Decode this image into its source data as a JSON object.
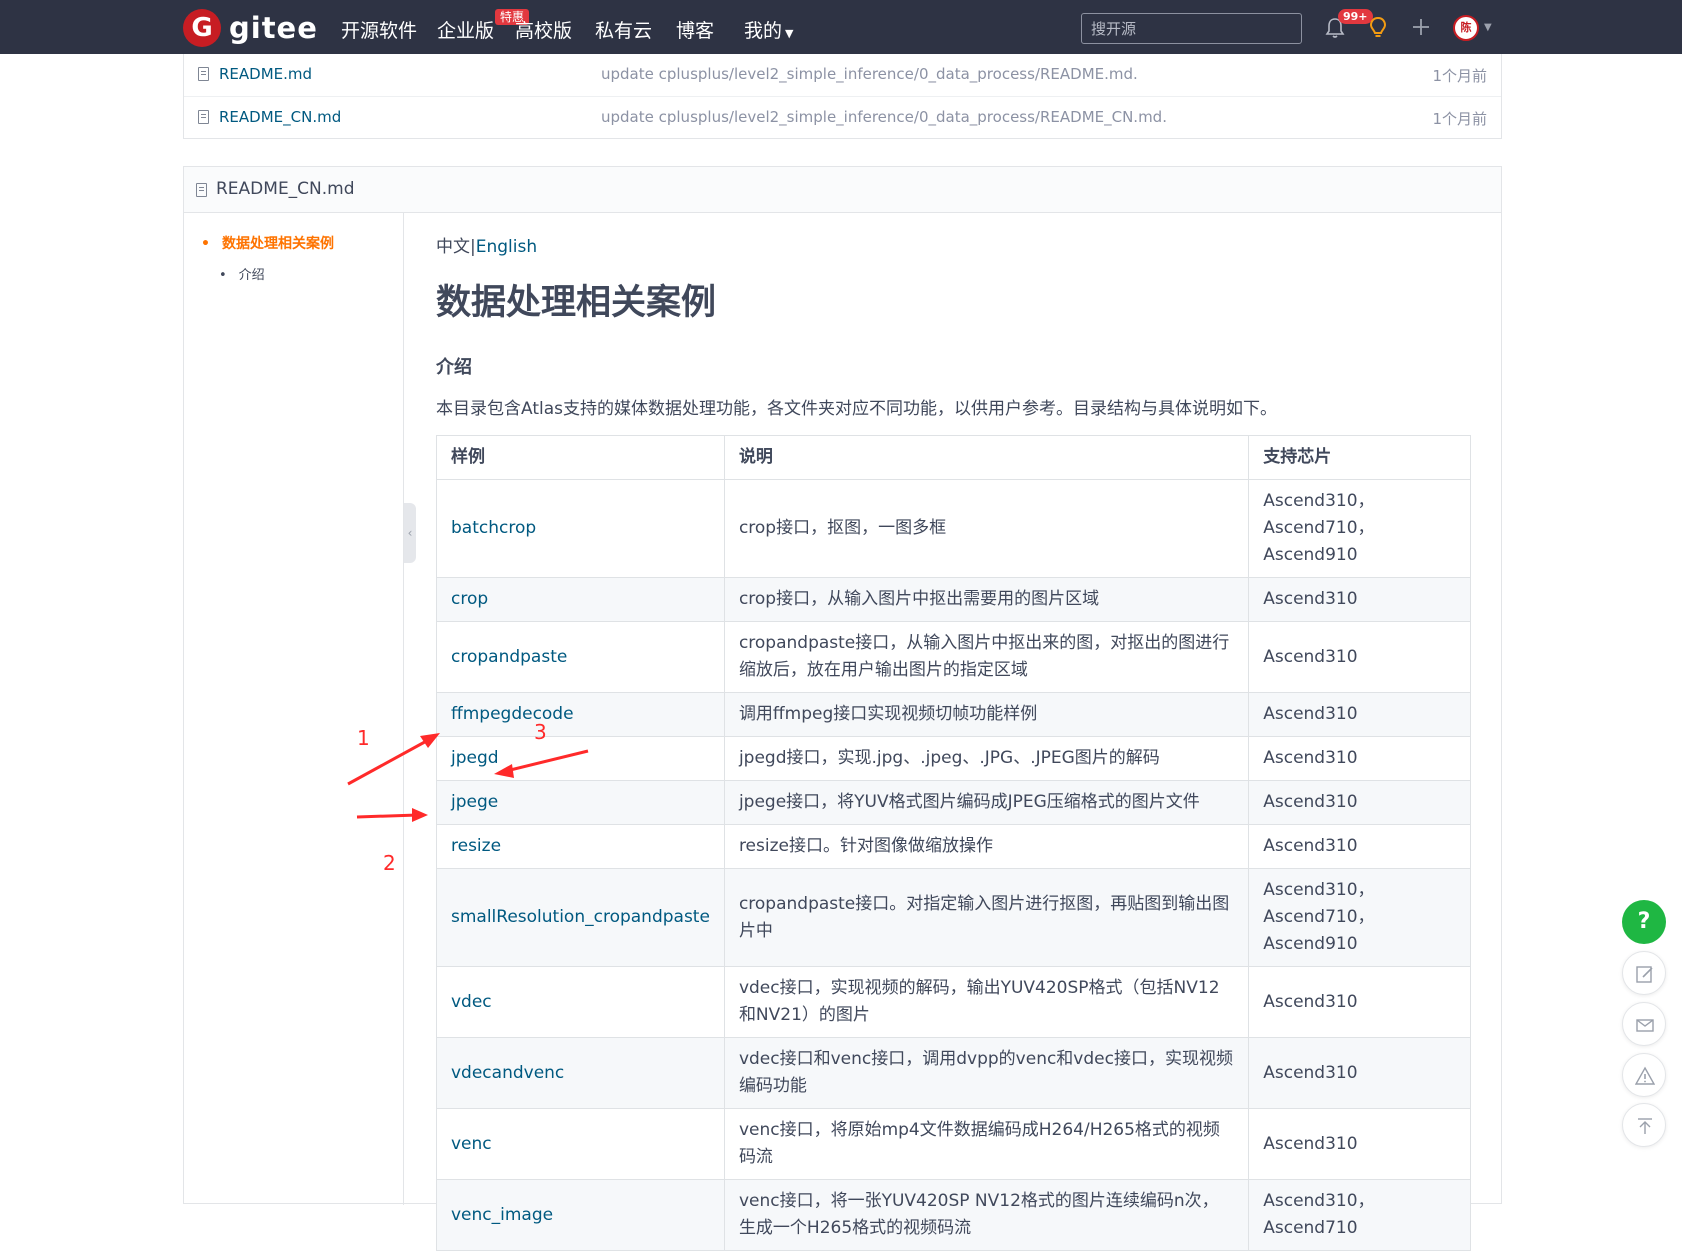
{
  "nav": {
    "logo_mark": "G",
    "logo_text": "gitee",
    "items": [
      {
        "label": "开源软件"
      },
      {
        "label": "企业版"
      },
      {
        "label": "高校版"
      },
      {
        "label": "私有云"
      },
      {
        "label": "博客"
      },
      {
        "label": "我的"
      }
    ],
    "enterprise_badge": "特惠",
    "search_placeholder": "搜开源",
    "notification_count": "99+",
    "avatar_text": "陈"
  },
  "files": [
    {
      "name": "README.md",
      "message": "update cplusplus/level2_simple_inference/0_data_process/README.md.",
      "time": "1个月前"
    },
    {
      "name": "README_CN.md",
      "message": "update cplusplus/level2_simple_inference/0_data_process/README_CN.md.",
      "time": "1个月前"
    }
  ],
  "readme": {
    "filename": "README_CN.md",
    "toc": {
      "main": "数据处理相关案例",
      "sub": "介绍"
    },
    "lang_zh": "中文",
    "lang_sep": "|",
    "lang_en": "English",
    "title": "数据处理相关案例",
    "section": "介绍",
    "intro": "本目录包含Atlas支持的媒体数据处理功能，各文件夹对应不同功能，以供用户参考。目录结构与具体说明如下。",
    "table": {
      "headers": [
        "样例",
        "说明",
        "支持芯片"
      ],
      "rows": [
        {
          "sample": "batchcrop",
          "desc": "crop接口，抠图，一图多框",
          "chip": "Ascend310，Ascend710，Ascend910"
        },
        {
          "sample": "crop",
          "desc": "crop接口，从输入图片中抠出需要用的图片区域",
          "chip": "Ascend310"
        },
        {
          "sample": "cropandpaste",
          "desc": "cropandpaste接口，从输入图片中抠出来的图，对抠出的图进行缩放后，放在用户输出图片的指定区域",
          "chip": "Ascend310"
        },
        {
          "sample": "ffmpegdecode",
          "desc": "调用ffmpeg接口实现视频切帧功能样例",
          "chip": "Ascend310"
        },
        {
          "sample": "jpegd",
          "desc": "jpegd接口，实现.jpg、.jpeg、.JPG、.JPEG图片的解码",
          "chip": "Ascend310"
        },
        {
          "sample": "jpege",
          "desc": "jpege接口，将YUV格式图片编码成JPEG压缩格式的图片文件",
          "chip": "Ascend310"
        },
        {
          "sample": "resize",
          "desc": "resize接口。针对图像做缩放操作",
          "chip": "Ascend310"
        },
        {
          "sample": "smallResolution_cropandpaste",
          "desc": "cropandpaste接口。对指定输入图片进行抠图，再贴图到输出图片中",
          "chip": "Ascend310，Ascend710，Ascend910"
        },
        {
          "sample": "vdec",
          "desc": "vdec接口，实现视频的解码，输出YUV420SP格式（包括NV12和NV21）的图片",
          "chip": "Ascend310"
        },
        {
          "sample": "vdecandvenc",
          "desc": "vdec接口和venc接口，调用dvpp的venc和vdec接口，实现视频编码功能",
          "chip": "Ascend310"
        },
        {
          "sample": "venc",
          "desc": "venc接口，将原始mp4文件数据编码成H264/H265格式的视频码流",
          "chip": "Ascend310"
        },
        {
          "sample": "venc_image",
          "desc": "venc接口，将一张YUV420SP NV12格式的图片连续编码n次，生成一个H265格式的视频码流",
          "chip": "Ascend310，Ascend710"
        }
      ]
    }
  },
  "annotations": {
    "a1": "1",
    "a2": "2",
    "a3": "3"
  },
  "side_buttons": {
    "help_label": "?"
  },
  "colors": {
    "nav_bg": "#2e3344",
    "brand": "#c71d23",
    "link": "#005980",
    "toc_active": "#fe7300",
    "annotation": "#ff2a2a",
    "help_button": "#1fb743"
  }
}
